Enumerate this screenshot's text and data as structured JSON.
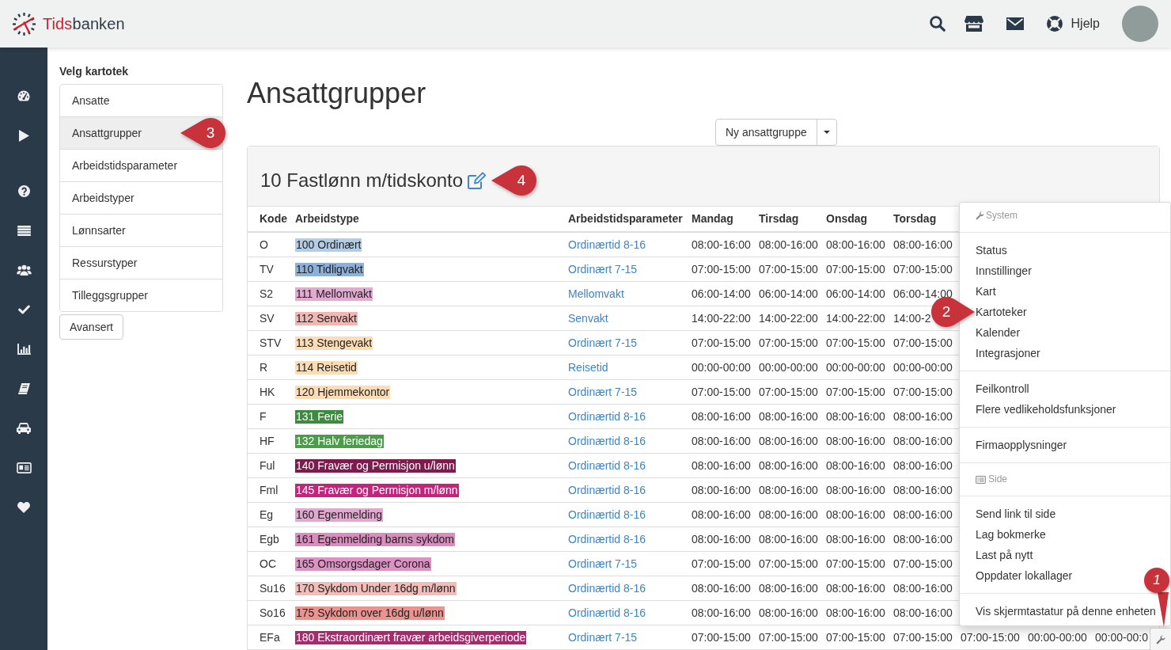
{
  "header": {
    "brand": {
      "accent": "Tids",
      "rest": "banken"
    },
    "help_label": "Hjelp"
  },
  "sidebar": {
    "heading": "Velg kartotek",
    "items": [
      {
        "label": "Ansatte",
        "selected": false
      },
      {
        "label": "Ansattgrupper",
        "selected": true,
        "callout": "3"
      },
      {
        "label": "Arbeidstidsparameter",
        "selected": false
      },
      {
        "label": "Arbeidstyper",
        "selected": false
      },
      {
        "label": "Lønnsarter",
        "selected": false
      },
      {
        "label": "Ressurstyper",
        "selected": false
      },
      {
        "label": "Tilleggsgrupper",
        "selected": false
      }
    ],
    "advanced_button": "Avansert"
  },
  "page": {
    "title": "Ansattgrupper",
    "new_button": "Ny ansattgruppe"
  },
  "group_panel": {
    "title": "10 Fastlønn m/tidskonto",
    "callout": "4",
    "table": {
      "columns": [
        "Kode",
        "Arbeidstype",
        "Arbeidstidsparameter",
        "Mandag",
        "Tirsdag",
        "Onsdag",
        "Torsdag"
      ],
      "rows": [
        {
          "code": "O",
          "work_type": {
            "label": "100 Ordinært",
            "color": "#b3cde6"
          },
          "parameter": "Ordinærtid 8-16",
          "times": [
            "08:00-16:00",
            "08:00-16:00",
            "08:00-16:00",
            "08:00-16:00"
          ]
        },
        {
          "code": "TV",
          "work_type": {
            "label": "110 Tidligvakt",
            "color": "#8db0d8"
          },
          "parameter": "Ordinært 7-15",
          "times": [
            "07:00-15:00",
            "07:00-15:00",
            "07:00-15:00",
            "07:00-15:00"
          ]
        },
        {
          "code": "S2",
          "work_type": {
            "label": "111 Mellomvakt",
            "color": "#e3a9d1"
          },
          "parameter": "Mellomvakt",
          "times": [
            "06:00-14:00",
            "06:00-14:00",
            "06:00-14:00",
            "06:00-14:00"
          ]
        },
        {
          "code": "SV",
          "work_type": {
            "label": "112 Senvakt",
            "color": "#f0b7b3"
          },
          "parameter": "Senvakt",
          "times": [
            "14:00-22:00",
            "14:00-22:00",
            "14:00-22:00",
            "14:00-2"
          ]
        },
        {
          "code": "STV",
          "work_type": {
            "label": "113 Stengevakt",
            "color": "#fbdcb5"
          },
          "parameter": "Ordinært 7-15",
          "times": [
            "07:00-15:00",
            "07:00-15:00",
            "07:00-15:00",
            "07:00-15:00"
          ]
        },
        {
          "code": "R",
          "work_type": {
            "label": "114 Reisetid",
            "color": "#fbdcb5"
          },
          "parameter": "Reisetid",
          "times": [
            "00:00-00:00",
            "00:00-00:00",
            "00:00-00:00",
            "00:00-00:00"
          ]
        },
        {
          "code": "HK",
          "work_type": {
            "label": "120 Hjemmekontor",
            "color": "#fbdcb5"
          },
          "parameter": "Ordinært 7-15",
          "times": [
            "07:00-15:00",
            "07:00-15:00",
            "07:00-15:00",
            "07:00-15:00"
          ]
        },
        {
          "code": "F",
          "work_type": {
            "label": "131 Ferie",
            "color": "#3d8a40"
          },
          "parameter": "Ordinærtid 8-16",
          "times": [
            "08:00-16:00",
            "08:00-16:00",
            "08:00-16:00",
            "08:00-16:00"
          ]
        },
        {
          "code": "HF",
          "work_type": {
            "label": "132 Halv feriedag",
            "color": "#4b9d49"
          },
          "parameter": "Ordinærtid 8-16",
          "times": [
            "08:00-16:00",
            "08:00-16:00",
            "08:00-16:00",
            "08:00-16:00"
          ]
        },
        {
          "code": "Ful",
          "work_type": {
            "label": "140 Fravær og Permisjon u/lønn",
            "color": "#7b1b4e"
          },
          "parameter": "Ordinærtid 8-16",
          "times": [
            "08:00-16:00",
            "08:00-16:00",
            "08:00-16:00",
            "08:00-16:00"
          ]
        },
        {
          "code": "Fml",
          "work_type": {
            "label": "145 Fravær og Permisjon m/lønn",
            "color": "#c4247d"
          },
          "parameter": "Ordinærtid 8-16",
          "times": [
            "08:00-16:00",
            "08:00-16:00",
            "08:00-16:00",
            "08:00-16:00"
          ]
        },
        {
          "code": "Eg",
          "work_type": {
            "label": "160 Egenmelding",
            "color": "#e1a8d0"
          },
          "parameter": "Ordinærtid 8-16",
          "times": [
            "08:00-16:00",
            "08:00-16:00",
            "08:00-16:00",
            "08:00-16:00"
          ]
        },
        {
          "code": "Egb",
          "work_type": {
            "label": "161 Egenmelding barns sykdom",
            "color": "#d98dbf"
          },
          "parameter": "Ordinærtid 8-16",
          "times": [
            "08:00-16:00",
            "08:00-16:00",
            "08:00-16:00",
            "08:00-16:00"
          ]
        },
        {
          "code": "OC",
          "work_type": {
            "label": "165 Omsorgsdager Corona",
            "color": "#dc93c4"
          },
          "parameter": "Ordinært 7-15",
          "times": [
            "07:00-15:00",
            "07:00-15:00",
            "07:00-15:00",
            "07:00-15:00"
          ]
        },
        {
          "code": "Su16",
          "work_type": {
            "label": "170 Sykdom Under 16dg m/lønn",
            "color": "#f2bcb8"
          },
          "parameter": "Ordinærtid 8-16",
          "times": [
            "08:00-16:00",
            "08:00-16:00",
            "08:00-16:00",
            "08:00-16:00"
          ]
        },
        {
          "code": "So16",
          "work_type": {
            "label": "175 Sykdom over 16dg u/lønn",
            "color": "#eb938e"
          },
          "parameter": "Ordinærtid 8-16",
          "times": [
            "08:00-16:00",
            "08:00-16:00",
            "08:00-16:00",
            "08:00-16:00"
          ]
        },
        {
          "code": "EFa",
          "work_type": {
            "label": "180 Ekstraordinært fravær arbeidsgiverperiode",
            "color": "#a62a6e"
          },
          "parameter": "Ordinært 7-15",
          "times": [
            "07:00-15:00",
            "07:00-15:00",
            "07:00-15:00",
            "07:00-15:00",
            "07:00-15:00",
            "00:00-00:00",
            "00:00-00:0"
          ]
        }
      ]
    }
  },
  "tools_menu": {
    "sections": [
      {
        "header": "System",
        "groups": [
          [
            {
              "label": "Status"
            },
            {
              "label": "Innstillinger"
            },
            {
              "label": "Kart"
            },
            {
              "label": "Kartoteker",
              "callout": "2"
            },
            {
              "label": "Kalender"
            },
            {
              "label": "Integrasjoner"
            }
          ],
          [
            {
              "label": "Feilkontroll"
            },
            {
              "label": "Flere vedlikeholdsfunksjoner"
            }
          ],
          [
            {
              "label": "Firmaopplysninger"
            }
          ]
        ]
      },
      {
        "header": "Side",
        "groups": [
          [
            {
              "label": "Send link til side"
            },
            {
              "label": "Lag bokmerke"
            },
            {
              "label": "Last på nytt"
            },
            {
              "label": "Oppdater lokallager"
            }
          ],
          [
            {
              "label": "Vis skjermtastatur på denne enheten"
            }
          ]
        ]
      }
    ]
  },
  "tools_button": {
    "callout": "1"
  }
}
